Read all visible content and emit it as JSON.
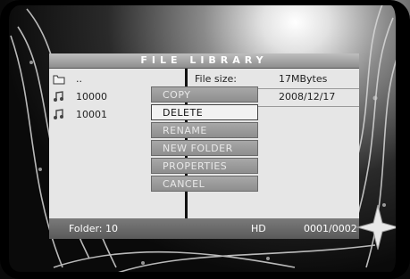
{
  "library": {
    "title": "FILE LIBRARY",
    "items": [
      {
        "name": "..",
        "icon": "parent-folder-icon"
      },
      {
        "name": "10000",
        "icon": "music-file-icon"
      },
      {
        "name": "10001",
        "icon": "music-file-icon"
      }
    ],
    "info": {
      "size_label": "File size:",
      "size_value": "17MBytes",
      "date_value": "2008/12/17"
    },
    "menu": {
      "items": [
        "COPY",
        "DELETE",
        "RENAME",
        "NEW FOLDER",
        "PROPERTIES",
        "CANCEL"
      ],
      "selected": "DELETE"
    },
    "status": {
      "folder": "Folder: 10",
      "media": "HD",
      "page": "0001/0002"
    }
  }
}
